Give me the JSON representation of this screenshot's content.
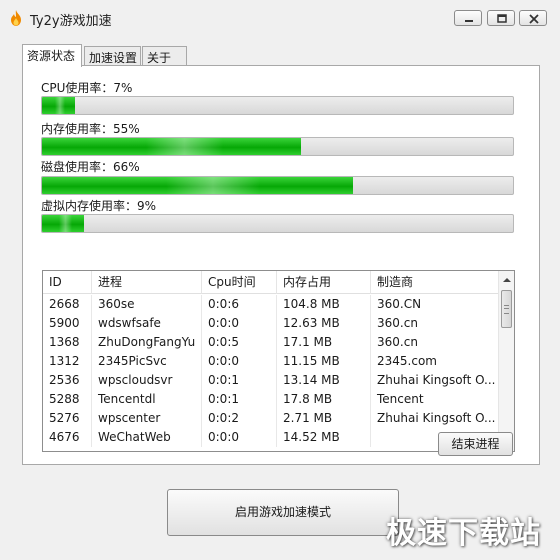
{
  "window": {
    "title": "Ty2y游戏加速",
    "icon": "flame-icon"
  },
  "tabs": [
    {
      "label": "资源状态",
      "active": true
    },
    {
      "label": "加速设置",
      "active": false
    },
    {
      "label": "关于",
      "active": false
    }
  ],
  "metrics": {
    "cpu": {
      "label": "CPU使用率：7%",
      "value": 0.07
    },
    "memory": {
      "label": "内存使用率：55%",
      "value": 0.55
    },
    "disk": {
      "label": "磁盘使用率：66%",
      "value": 0.66
    },
    "virtual": {
      "label": "虚拟内存使用率：9%",
      "value": 0.09
    }
  },
  "table": {
    "columns": [
      "ID",
      "进程",
      "Cpu时间",
      "内存占用",
      "制造商"
    ],
    "rows": [
      [
        "2668",
        "360se",
        "0:0:6",
        "104.8 MB",
        "360.CN"
      ],
      [
        "5900",
        "wdswfsafe",
        "0:0:0",
        "12.63 MB",
        "360.cn"
      ],
      [
        "1368",
        "ZhuDongFangYu",
        "0:0:5",
        "17.1 MB",
        "360.cn"
      ],
      [
        "1312",
        "2345PicSvc",
        "0:0:0",
        "11.15 MB",
        "2345.com"
      ],
      [
        "2536",
        "wpscloudsvr",
        "0:0:1",
        "13.14 MB",
        "Zhuhai Kingsoft O..."
      ],
      [
        "5288",
        "Tencentdl",
        "0:0:1",
        "17.8 MB",
        "Tencent"
      ],
      [
        "5276",
        "wpscenter",
        "0:0:2",
        "2.71 MB",
        "Zhuhai Kingsoft O..."
      ],
      [
        "4676",
        "WeChatWeb",
        "0:0:0",
        "14.52 MB",
        ""
      ]
    ]
  },
  "buttons": {
    "end_process": "结束进程",
    "enable_mode": "启用游戏加速模式"
  },
  "watermark": "极速下载站",
  "colors": {
    "progress_green": "#10b010",
    "window_bg": "#f0f0f0"
  }
}
